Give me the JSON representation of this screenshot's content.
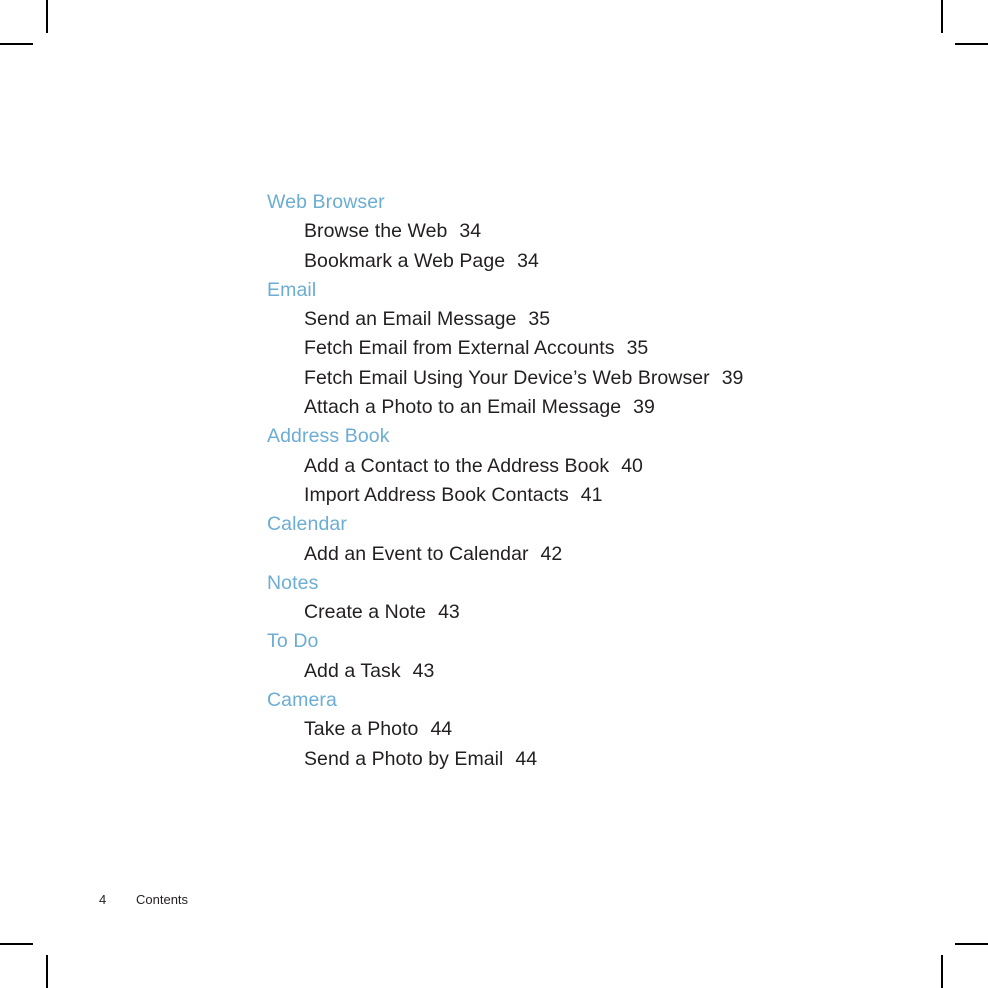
{
  "page": {
    "background_color": "#ffffff",
    "heading_color": "#6badd3",
    "text_color": "#231f20",
    "crop_mark_color": "#000000"
  },
  "toc": {
    "groups": [
      {
        "heading": "Web Browser",
        "entries": [
          {
            "title": "Browse the Web",
            "page": "34"
          },
          {
            "title": "Bookmark a Web Page",
            "page": "34"
          }
        ]
      },
      {
        "heading": "Email",
        "entries": [
          {
            "title": "Send an Email Message",
            "page": "35"
          },
          {
            "title": "Fetch Email from External Accounts",
            "page": "35"
          },
          {
            "title": "Fetch Email Using Your Device’s Web Browser",
            "page": "39"
          },
          {
            "title": "Attach a Photo to an Email Message",
            "page": "39"
          }
        ]
      },
      {
        "heading": "Address Book",
        "entries": [
          {
            "title": "Add a Contact to the Address Book",
            "page": "40"
          },
          {
            "title": "Import Address Book Contacts",
            "page": "41"
          }
        ]
      },
      {
        "heading": "Calendar",
        "entries": [
          {
            "title": "Add an Event to Calendar",
            "page": "42"
          }
        ]
      },
      {
        "heading": "Notes",
        "entries": [
          {
            "title": "Create a Note",
            "page": "43"
          }
        ]
      },
      {
        "heading": "To Do",
        "entries": [
          {
            "title": "Add a Task",
            "page": "43"
          }
        ]
      },
      {
        "heading": "Camera",
        "entries": [
          {
            "title": "Take a Photo",
            "page": "44"
          },
          {
            "title": "Send a Photo by Email",
            "page": "44"
          }
        ]
      }
    ]
  },
  "footer": {
    "page_number": "4",
    "section_label": "Contents"
  }
}
